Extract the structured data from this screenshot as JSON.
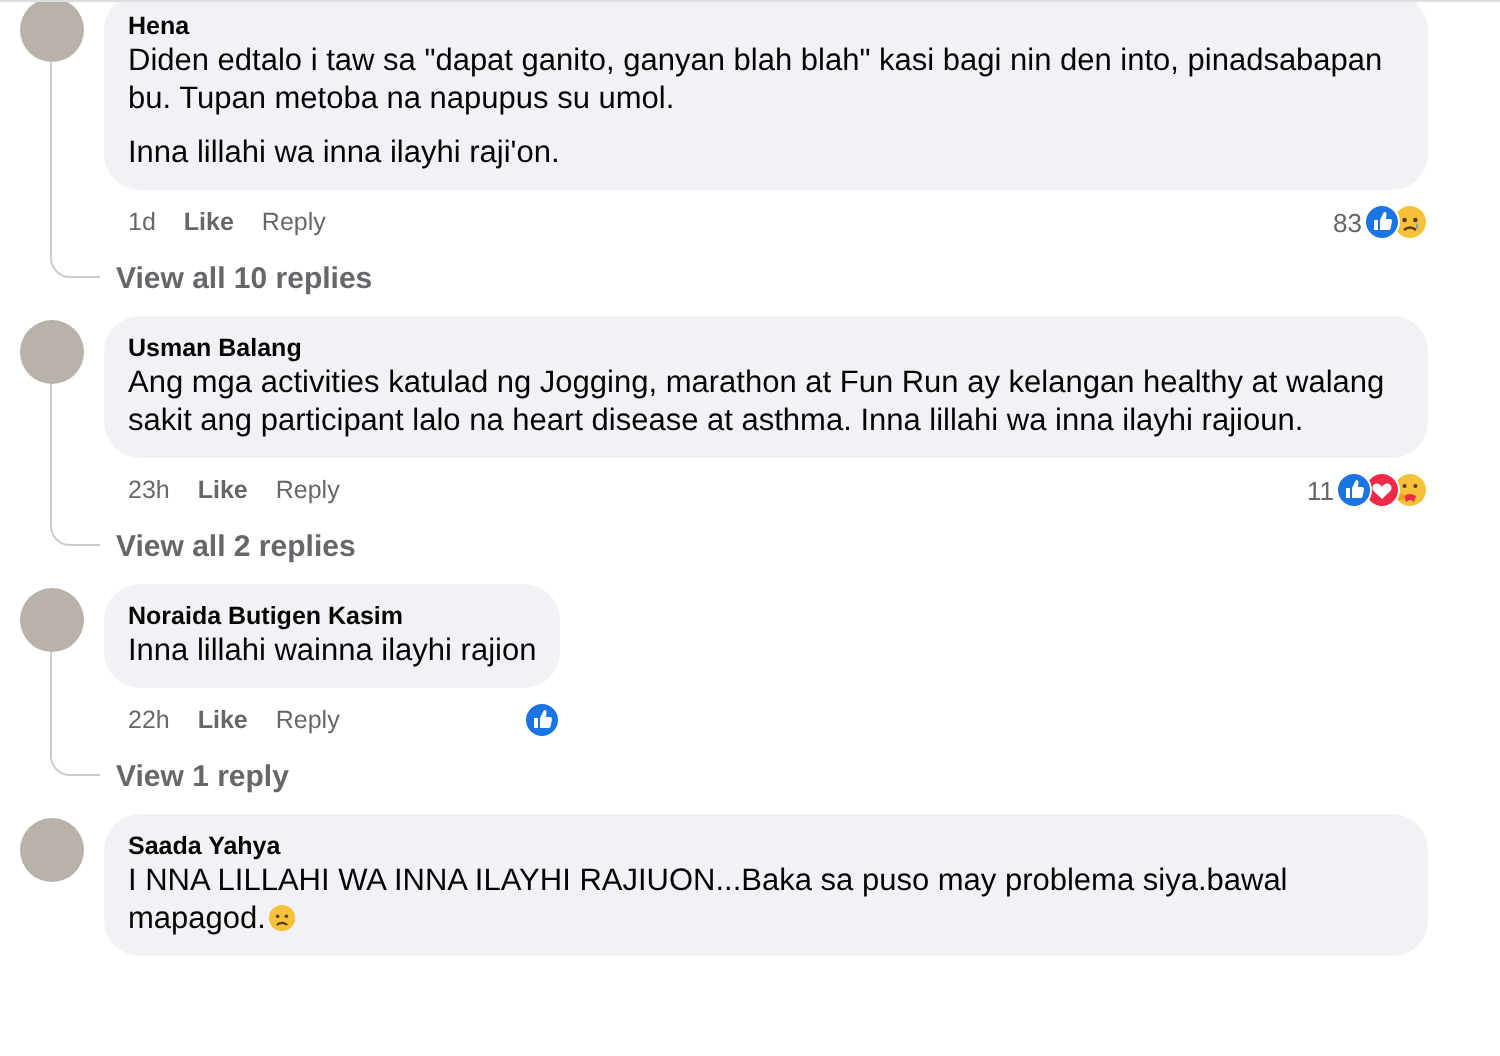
{
  "comments": [
    {
      "name": "Hena",
      "paragraphs": [
        "Diden edtalo i taw sa \"dapat ganito, ganyan blah blah\" kasi bagi nin den into, pinadsabapan bu. Tupan metoba na napupus su umol.",
        "Inna lillahi wa inna ilayhi raji'on."
      ],
      "time": "1d",
      "like": "Like",
      "reply": "Reply",
      "reaction_count": "83",
      "reactions": [
        {
          "kind": "like"
        },
        {
          "kind": "sad"
        }
      ],
      "replies_link": "View all 10 replies"
    },
    {
      "name": "Usman Balang",
      "paragraphs": [
        "Ang mga activities katulad ng Jogging, marathon at Fun Run ay kelangan healthy at walang sakit ang participant lalo na heart disease at asthma. Inna lillahi wa inna ilayhi rajioun."
      ],
      "time": "23h",
      "like": "Like",
      "reply": "Reply",
      "reaction_count": "11",
      "reactions": [
        {
          "kind": "like"
        },
        {
          "kind": "love"
        },
        {
          "kind": "care"
        }
      ],
      "replies_link": "View all 2 replies"
    },
    {
      "name": "Noraida Butigen Kasim",
      "paragraphs": [
        "Inna lillahi wainna ilayhi rajion"
      ],
      "time": "22h",
      "like": "Like",
      "reply": "Reply",
      "reactions": [
        {
          "kind": "like"
        }
      ],
      "replies_link": "View 1 reply"
    },
    {
      "name": "Saada Yahya",
      "paragraphs": [
        "I NNA LILLAHI WA INNA ILAYHI RAJIUON...Baka sa puso may problema siya.bawal mapagod."
      ],
      "trailing_emoji": {
        "kind": "sad"
      }
    }
  ]
}
